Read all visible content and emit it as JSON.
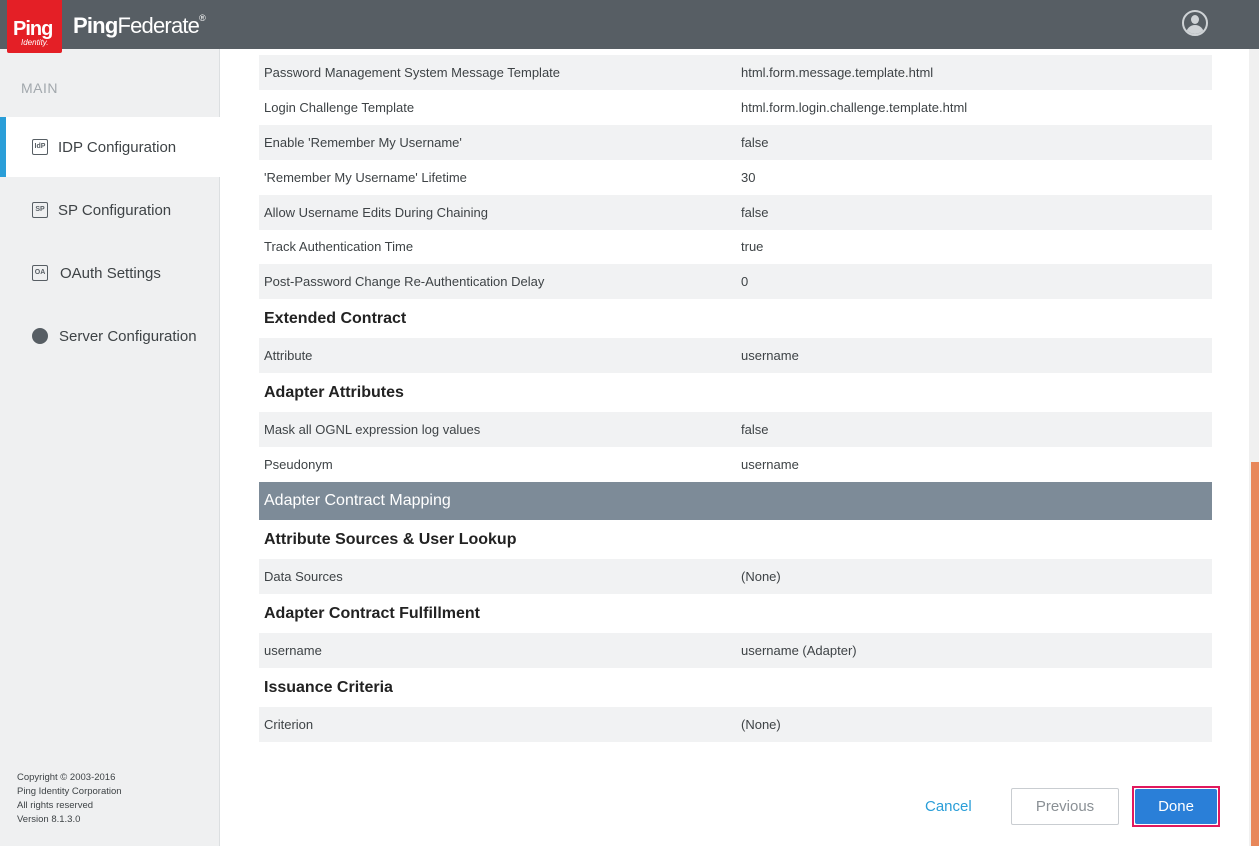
{
  "header": {
    "logo_word": "Ping",
    "logo_sub": "Identity.",
    "product_bold": "Ping",
    "product_rest": "Federate",
    "product_mark": "®"
  },
  "sidebar": {
    "section": "MAIN",
    "items": [
      {
        "label": "IDP Configuration",
        "icon": "idp-icon",
        "icon_text": "IdP"
      },
      {
        "label": "SP Configuration",
        "icon": "sp-icon",
        "icon_text": "SP"
      },
      {
        "label": "OAuth Settings",
        "icon": "oauth-icon",
        "icon_text": "OA"
      },
      {
        "label": "Server Configuration",
        "icon": "server-icon",
        "icon_text": ""
      }
    ],
    "copyright": {
      "line1": "Copyright © 2003-2016",
      "line2": "Ping Identity Corporation",
      "line3": "All rights reserved",
      "line4": "Version 8.1.3.0"
    }
  },
  "main": {
    "rows_top": [
      {
        "key": "Password Management System Message Template",
        "value": "html.form.message.template.html"
      },
      {
        "key": "Login Challenge Template",
        "value": "html.form.login.challenge.template.html"
      },
      {
        "key": "Enable 'Remember My Username'",
        "value": "false"
      },
      {
        "key": "'Remember My Username' Lifetime",
        "value": "30"
      },
      {
        "key": "Allow Username Edits During Chaining",
        "value": "false"
      },
      {
        "key": "Track Authentication Time",
        "value": "true"
      },
      {
        "key": "Post-Password Change Re-Authentication Delay",
        "value": "0"
      }
    ],
    "extended_contract": {
      "heading": "Extended Contract",
      "rows": [
        {
          "key": "Attribute",
          "value": "username"
        }
      ]
    },
    "adapter_attributes": {
      "heading": "Adapter Attributes",
      "rows": [
        {
          "key": "Mask all OGNL expression log values",
          "value": "false"
        },
        {
          "key": "Pseudonym",
          "value": "username"
        }
      ]
    },
    "band": "Adapter Contract Mapping",
    "attribute_sources": {
      "heading": "Attribute Sources & User Lookup",
      "rows": [
        {
          "key": "Data Sources",
          "value": "(None)"
        }
      ]
    },
    "contract_fulfillment": {
      "heading": "Adapter Contract Fulfillment",
      "rows": [
        {
          "key": "username",
          "value": "username (Adapter)"
        }
      ]
    },
    "issuance_criteria": {
      "heading": "Issuance Criteria",
      "rows": [
        {
          "key": "Criterion",
          "value": "(None)"
        }
      ]
    }
  },
  "footer": {
    "cancel": "Cancel",
    "previous": "Previous",
    "done": "Done"
  },
  "colors": {
    "accent": "#2a9ed8",
    "topbar": "#575e64",
    "band": "#7d8b98",
    "logo": "#e41f26",
    "done": "#2a7fd8"
  }
}
